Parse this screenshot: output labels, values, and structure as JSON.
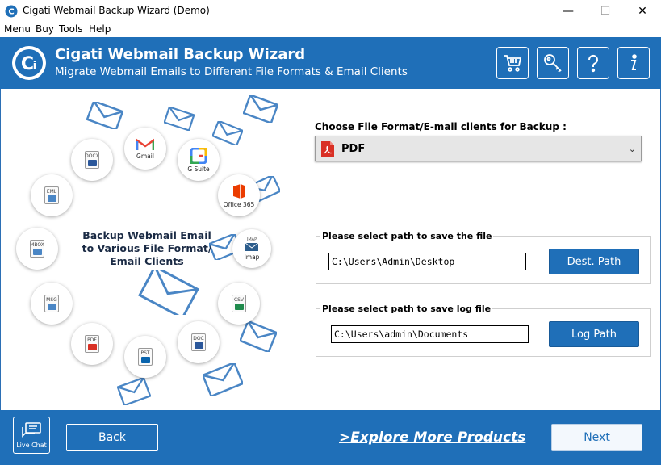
{
  "window": {
    "title": "Cigati Webmail Backup Wizard (Demo)",
    "minimize": "—",
    "maximize": "☐",
    "close": "✕"
  },
  "menu": [
    "Menu",
    "Buy",
    "Tools",
    "Help"
  ],
  "header": {
    "title": "Cigati Webmail Backup Wizard",
    "subtitle": "Migrate Webmail Emails to Different File Formats & Email Clients",
    "buttons": [
      "cart-icon",
      "key-icon",
      "help-icon",
      "info-icon"
    ]
  },
  "illustration": {
    "center_text": [
      "Backup Webmail Email",
      "to Various File Format/",
      "Email Clients"
    ],
    "icons": {
      "gmail": "Gmail",
      "gsuite": "G Suite",
      "office365": "Office 365",
      "imap": "Imap",
      "imap_tag": "IMAP",
      "csv": "CSV",
      "doc": "DOC",
      "pst": "PST",
      "pdf": "PDF",
      "msg": "MSG",
      "mbox": "MBOX",
      "eml": "EML",
      "docx": "DOCX"
    }
  },
  "form": {
    "choose_label": "Choose File Format/E-mail clients for Backup :",
    "format_value": "PDF",
    "save_group_title": "Please select path to save the file",
    "save_path": "C:\\Users\\Admin\\Desktop",
    "dest_button": "Dest. Path",
    "log_group_title": "Please select path to save log file",
    "log_path": "C:\\Users\\admin\\Documents",
    "log_button": "Log Path"
  },
  "footer": {
    "live_chat": "Live Chat",
    "back": "Back",
    "explore": ">Explore More Products",
    "next": "Next"
  },
  "colors": {
    "brand_blue": "#1f6fb8",
    "envelope_blue": "#4a86c5",
    "pdf_red": "#d93025"
  }
}
